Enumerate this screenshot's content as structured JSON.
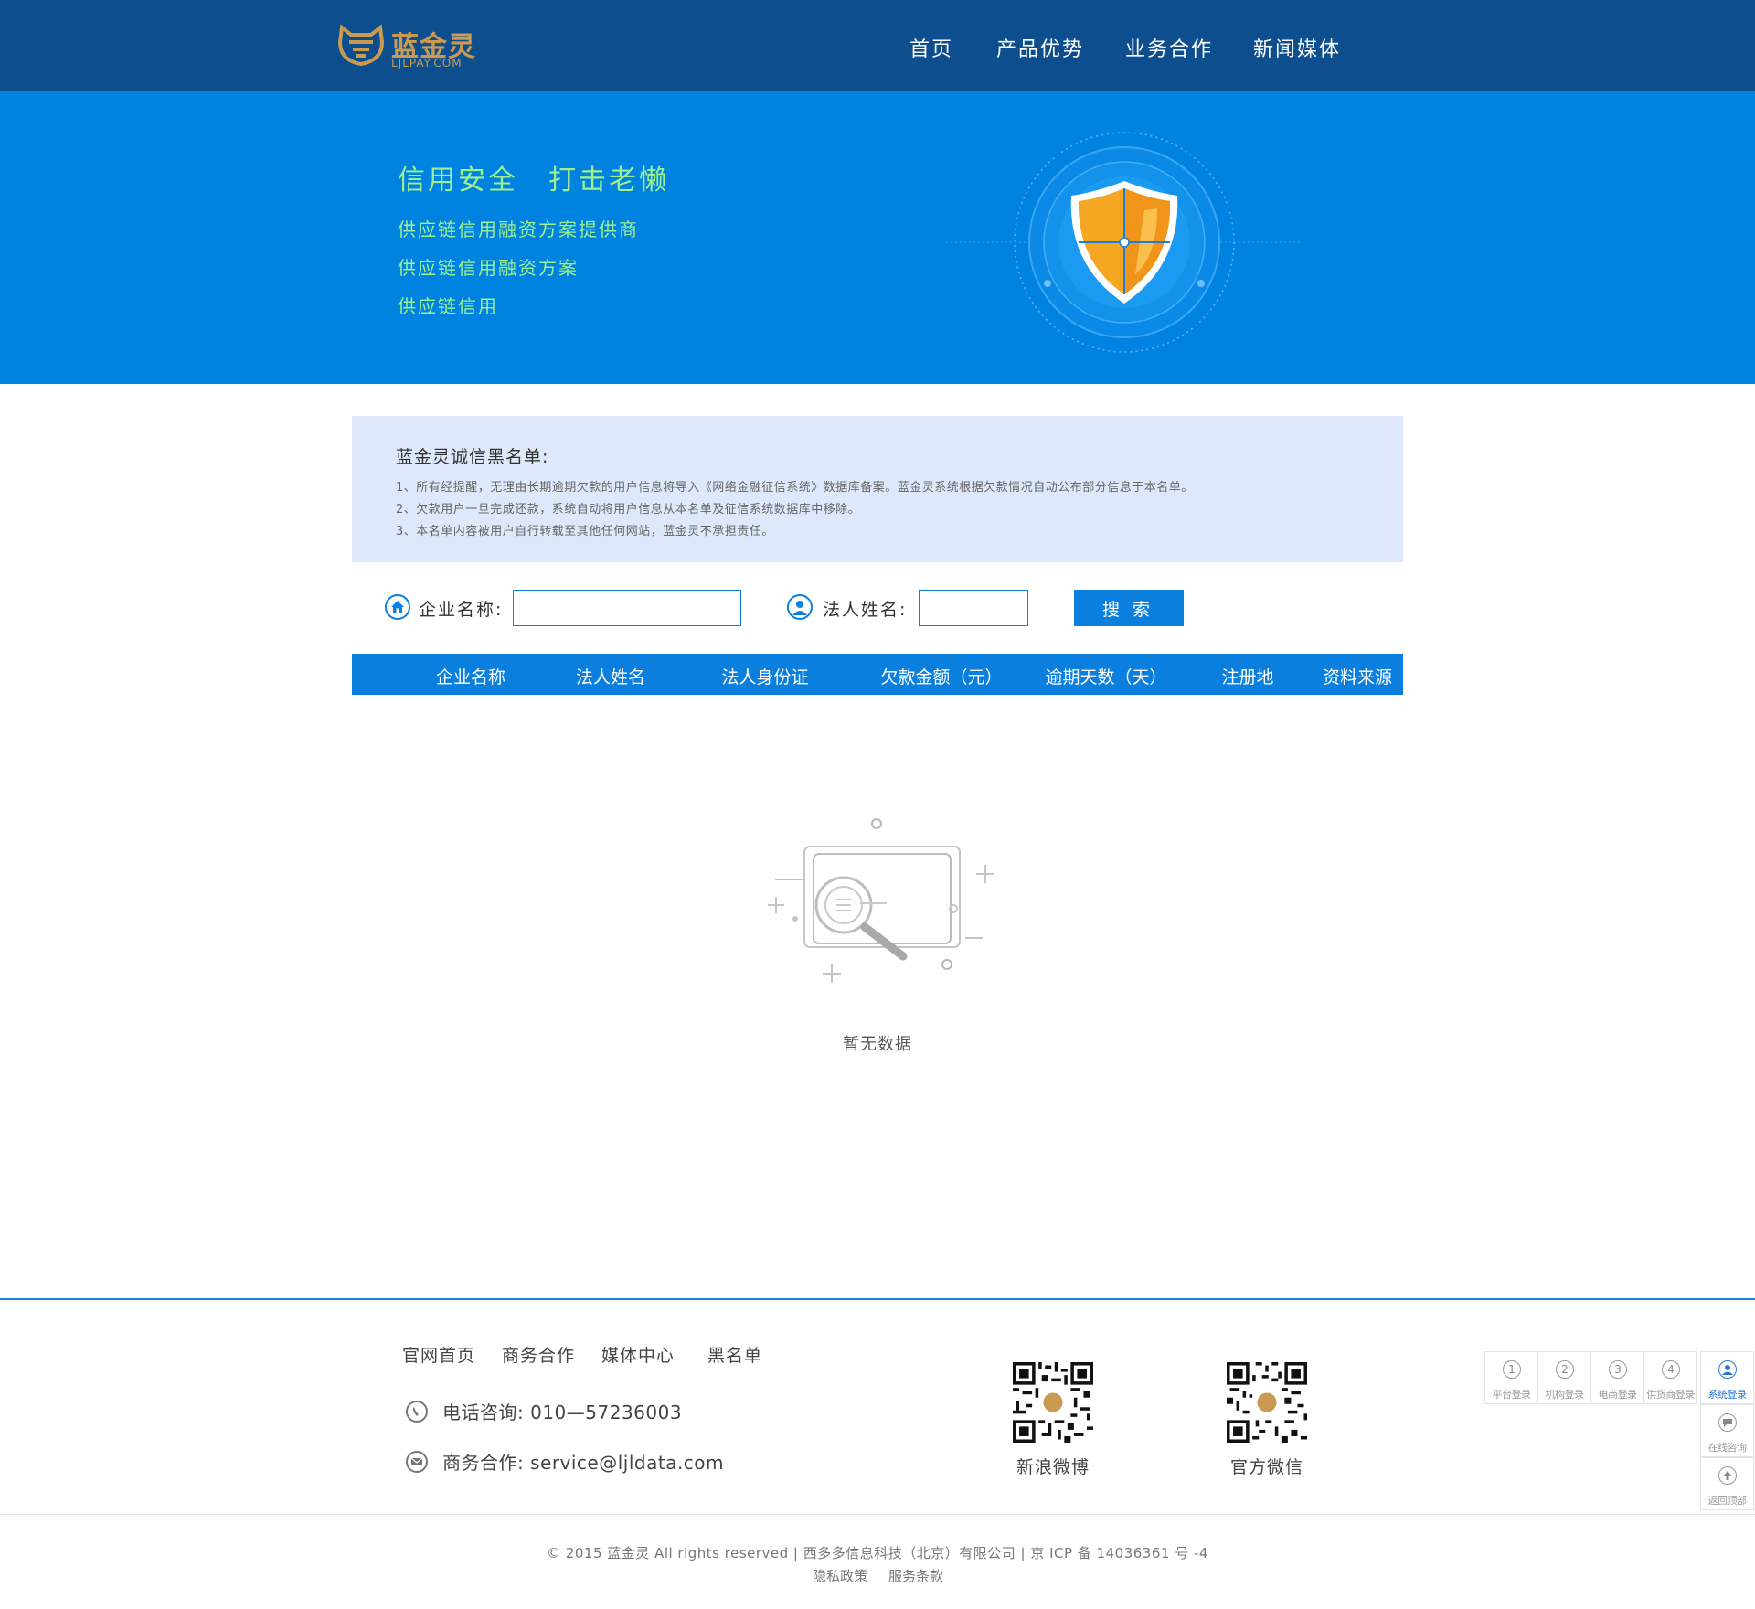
{
  "header": {
    "logo_cn": "蓝金灵",
    "logo_en": "LJLPAY.COM",
    "nav": [
      "首页",
      "产品优势",
      "业务合作",
      "新闻媒体"
    ]
  },
  "banner": {
    "title": "信用安全　打击老懒",
    "lines": [
      "供应链信用融资方案提供商",
      "供应链信用融资方案",
      "供应链信用"
    ]
  },
  "notice": {
    "title": "蓝金灵诚信黑名单:",
    "items": [
      "1、所有经提醒，无理由长期逾期欠款的用户信息将导入《网络金融征信系统》数据库备案。蓝金灵系统根据欠款情况自动公布部分信息于本名单。",
      "2、欠款用户一旦完成还款，系统自动将用户信息从本名单及征信系统数据库中移除。",
      "3、本名单内容被用户自行转载至其他任何网站，蓝金灵不承担责任。"
    ]
  },
  "search": {
    "company_label": "企业名称:",
    "company_value": "",
    "person_label": "法人姓名:",
    "person_value": "",
    "button": "搜索"
  },
  "table": {
    "columns": [
      "企业名称",
      "法人姓名",
      "法人身份证",
      "欠款金额（元）",
      "逾期天数（天）",
      "注册地",
      "资料来源"
    ]
  },
  "empty_state": {
    "text": "暂无数据"
  },
  "footer": {
    "links": [
      "官网首页",
      "商务合作",
      "媒体中心",
      "黑名单"
    ],
    "phone": "电话咨询: 010—57236003",
    "email": "商务合作: service@ljldata.com",
    "qr_labels": [
      "新浪微博",
      "官方微信"
    ],
    "copyright": "© 2015 蓝金灵 All rights reserved | 西多多信息科技（北京）有限公司 | 京 ICP 备 14036361 号 -4",
    "sublinks": [
      "隐私政策",
      "服务条款"
    ]
  },
  "side_bar": {
    "logins": [
      {
        "num": "1",
        "label": "平台登录"
      },
      {
        "num": "2",
        "label": "机构登录"
      },
      {
        "num": "3",
        "label": "电商登录"
      },
      {
        "num": "4",
        "label": "供货商登录"
      }
    ],
    "system_login": "系统登录",
    "online_consult": "在线咨询",
    "back_to_top": "返回顶部"
  },
  "colors": {
    "header_bg": "#0d4e8f",
    "banner_bg": "#0083e0",
    "banner_text": "#9ef08f",
    "accent": "#0b7fde",
    "notice_bg": "#dde8fb",
    "logo_gold": "#c99a4f"
  }
}
